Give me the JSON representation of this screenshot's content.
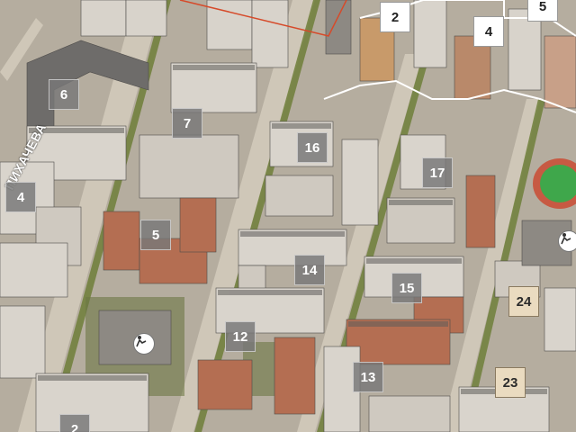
{
  "map": {
    "street_name": "ПИХАЧЕВА",
    "labels": [
      {
        "text": "2",
        "style": "white"
      },
      {
        "text": "4",
        "style": "white"
      },
      {
        "text": "5",
        "style": "white"
      },
      {
        "text": "6",
        "style": "gray"
      },
      {
        "text": "7",
        "style": "gray"
      },
      {
        "text": "16",
        "style": "gray"
      },
      {
        "text": "17",
        "style": "gray"
      },
      {
        "text": "4",
        "style": "gray"
      },
      {
        "text": "5",
        "style": "gray"
      },
      {
        "text": "14",
        "style": "gray"
      },
      {
        "text": "15",
        "style": "gray"
      },
      {
        "text": "24",
        "style": "beige"
      },
      {
        "text": "12",
        "style": "gray"
      },
      {
        "text": "13",
        "style": "gray"
      },
      {
        "text": "23",
        "style": "beige"
      },
      {
        "text": "2",
        "style": "gray"
      }
    ],
    "poi_icons": [
      "kindergarten-icon",
      "kindergarten-icon"
    ],
    "colors": {
      "ground": "#b9b2a4",
      "roof_gray": "#6e6c6a",
      "facade_light": "#d9d4cc",
      "facade_brick": "#b46e52",
      "trees": "#6f7f3a",
      "boundary": "#d64a2a"
    }
  }
}
